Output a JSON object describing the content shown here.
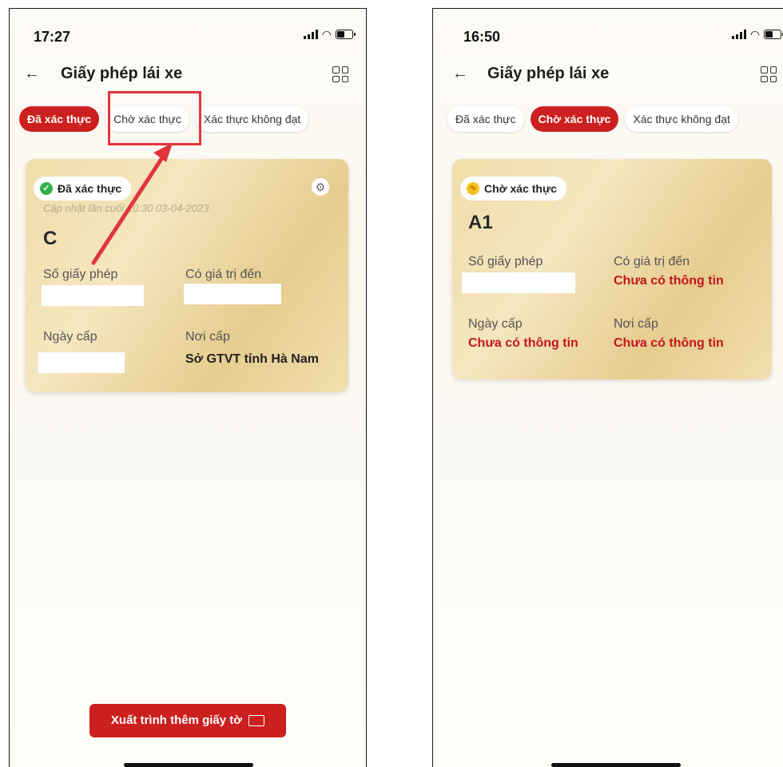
{
  "screens": [
    {
      "status": {
        "time": "17:27"
      },
      "header": {
        "title": "Giấy phép lái xe"
      },
      "tabs": [
        "Đã xác thực",
        "Chờ xác thực",
        "Xác thực không đạt"
      ],
      "active_tab": 0,
      "card": {
        "badge": "Đã xác thực",
        "updated": "Cập nhật lần cuối 10:30 03-04-2023",
        "class": "C",
        "license_no_label": "Số giấy phép",
        "valid_until_label": "Có giá trị đến",
        "issue_date_label": "Ngày cấp",
        "issue_place_label": "Nơi cấp",
        "issue_place": "Sở GTVT tỉnh Hà Nam"
      },
      "export_button": "Xuất trình thêm giấy tờ"
    },
    {
      "status": {
        "time": "16:50"
      },
      "header": {
        "title": "Giấy phép lái xe"
      },
      "tabs": [
        "Đã xác thực",
        "Chờ xác thực",
        "Xác thực không đạt"
      ],
      "active_tab": 1,
      "card": {
        "badge": "Chờ xác thực",
        "class": "A1",
        "license_no_label": "Số giấy phép",
        "valid_until_label": "Có giá trị đến",
        "valid_until": "Chưa có thông tin",
        "issue_date_label": "Ngày cấp",
        "issue_date": "Chưa có thông tin",
        "issue_place_label": "Nơi cấp",
        "issue_place": "Chưa có thông tin"
      }
    }
  ],
  "colors": {
    "accent": "#cc1f1f",
    "highlight": "#e0353b",
    "verified": "#2fb34a",
    "pending": "#f5c21a"
  }
}
